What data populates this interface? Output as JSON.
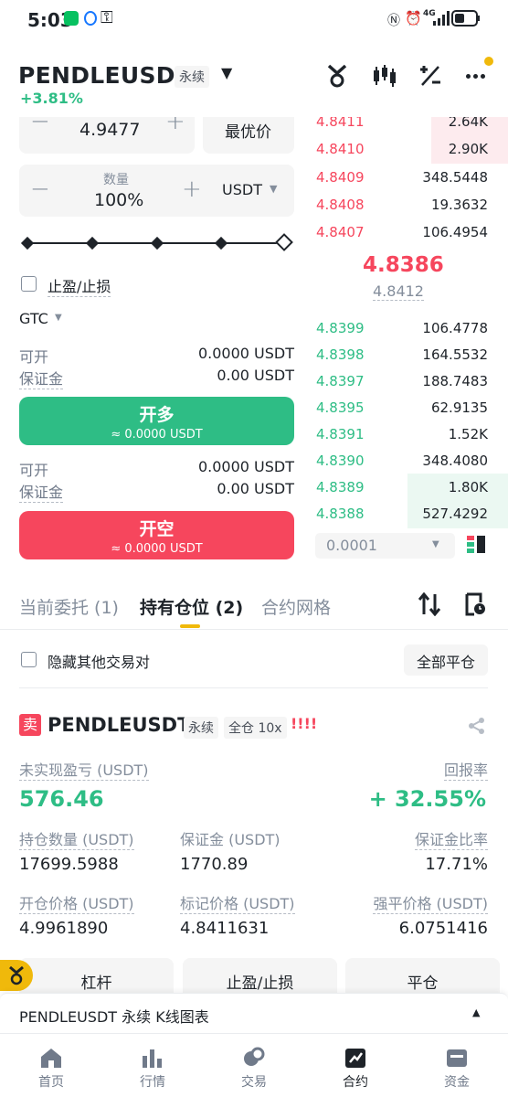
{
  "status": {
    "time": "5:03",
    "network": "4G"
  },
  "header": {
    "pair": "PENDLEUSDT",
    "perp_tag": "永续",
    "change": "+3.81%"
  },
  "form": {
    "price_value": "4.9477",
    "best_price": "最优价",
    "qty_label": "数量",
    "qty_value": "100%",
    "qty_unit": "USDT",
    "tpsl_label": "止盈/止损",
    "tif": "GTC",
    "long": {
      "avail_label": "可开",
      "avail_value": "0.0000 USDT",
      "margin_label": "保证金",
      "margin_value": "0.00 USDT",
      "button": "开多",
      "button_sub": "≈ 0.0000 USDT"
    },
    "short": {
      "avail_label": "可开",
      "avail_value": "0.0000 USDT",
      "margin_label": "保证金",
      "margin_value": "0.00 USDT",
      "button": "开空",
      "button_sub": "≈ 0.0000 USDT"
    }
  },
  "orderbook": {
    "asks": [
      {
        "price": "4.8411",
        "qty": "2.64K",
        "depth": 0.45
      },
      {
        "price": "4.8410",
        "qty": "2.90K",
        "depth": 0.45
      },
      {
        "price": "4.8409",
        "qty": "348.5448",
        "depth": 0
      },
      {
        "price": "4.8408",
        "qty": "19.3632",
        "depth": 0
      },
      {
        "price": "4.8407",
        "qty": "106.4954",
        "depth": 0
      }
    ],
    "last_price": "4.8386",
    "mark_price": "4.8412",
    "bids": [
      {
        "price": "4.8399",
        "qty": "106.4778",
        "depth": 0
      },
      {
        "price": "4.8398",
        "qty": "164.5532",
        "depth": 0
      },
      {
        "price": "4.8397",
        "qty": "188.7483",
        "depth": 0
      },
      {
        "price": "4.8395",
        "qty": "62.9135",
        "depth": 0
      },
      {
        "price": "4.8391",
        "qty": "1.52K",
        "depth": 0
      },
      {
        "price": "4.8390",
        "qty": "348.4080",
        "depth": 0
      },
      {
        "price": "4.8389",
        "qty": "1.80K",
        "depth": 0.45
      },
      {
        "price": "4.8388",
        "qty": "527.4292",
        "depth": 0.45
      }
    ],
    "precision": "0.0001"
  },
  "tabs": {
    "open_orders": "当前委托 (1)",
    "positions": "持有仓位 (2)",
    "grid": "合约网格"
  },
  "filter": {
    "hide_others": "隐藏其他交易对",
    "close_all": "全部平仓"
  },
  "position": {
    "side_badge": "卖",
    "pair": "PENDLEUSDT",
    "perp_tag": "永续",
    "margin_tag": "全仓 10x",
    "warn": "!!!!",
    "pnl_label": "未实现盈亏 (USDT)",
    "pnl_value": "576.46",
    "roe_label": "回报率",
    "roe_value": "+ 32.55%",
    "size_label": "持仓数量 (USDT)",
    "size_value": "17699.5988",
    "margin_label": "保证金 (USDT)",
    "margin_value": "1770.89",
    "margin_ratio_label": "保证金比率",
    "margin_ratio_value": "17.71%",
    "entry_label": "开仓价格 (USDT)",
    "entry_value": "4.9961890",
    "mark_label": "标记价格 (USDT)",
    "mark_value": "4.8411631",
    "liq_label": "强平价格 (USDT)",
    "liq_value": "6.0751416",
    "btn_leverage": "杠杆",
    "btn_tpsl": "止盈/止损",
    "btn_close": "平仓"
  },
  "chart_bar": {
    "label": "PENDLEUSDT 永续 K线图表"
  },
  "nav": {
    "home": "首页",
    "markets": "行情",
    "trade": "交易",
    "futures": "合约",
    "assets": "资金"
  },
  "colors": {
    "green": "#2ebd85",
    "red": "#f6465d",
    "brand": "#f0b90b",
    "text": "#1e2329",
    "muted": "#848e9c"
  }
}
